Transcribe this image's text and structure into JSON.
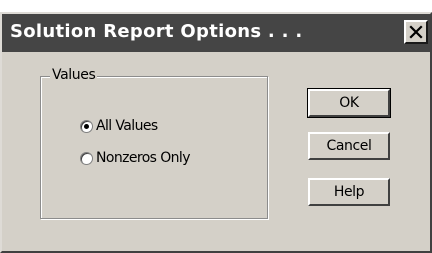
{
  "dialog": {
    "title": "Solution Report Options . . .",
    "close_icon": "close-icon"
  },
  "values_group": {
    "legend": "Values",
    "options": [
      {
        "label": "All Values",
        "selected": true
      },
      {
        "label": "Nonzeros Only",
        "selected": false
      }
    ]
  },
  "buttons": {
    "ok": "OK",
    "cancel": "Cancel",
    "help": "Help"
  }
}
